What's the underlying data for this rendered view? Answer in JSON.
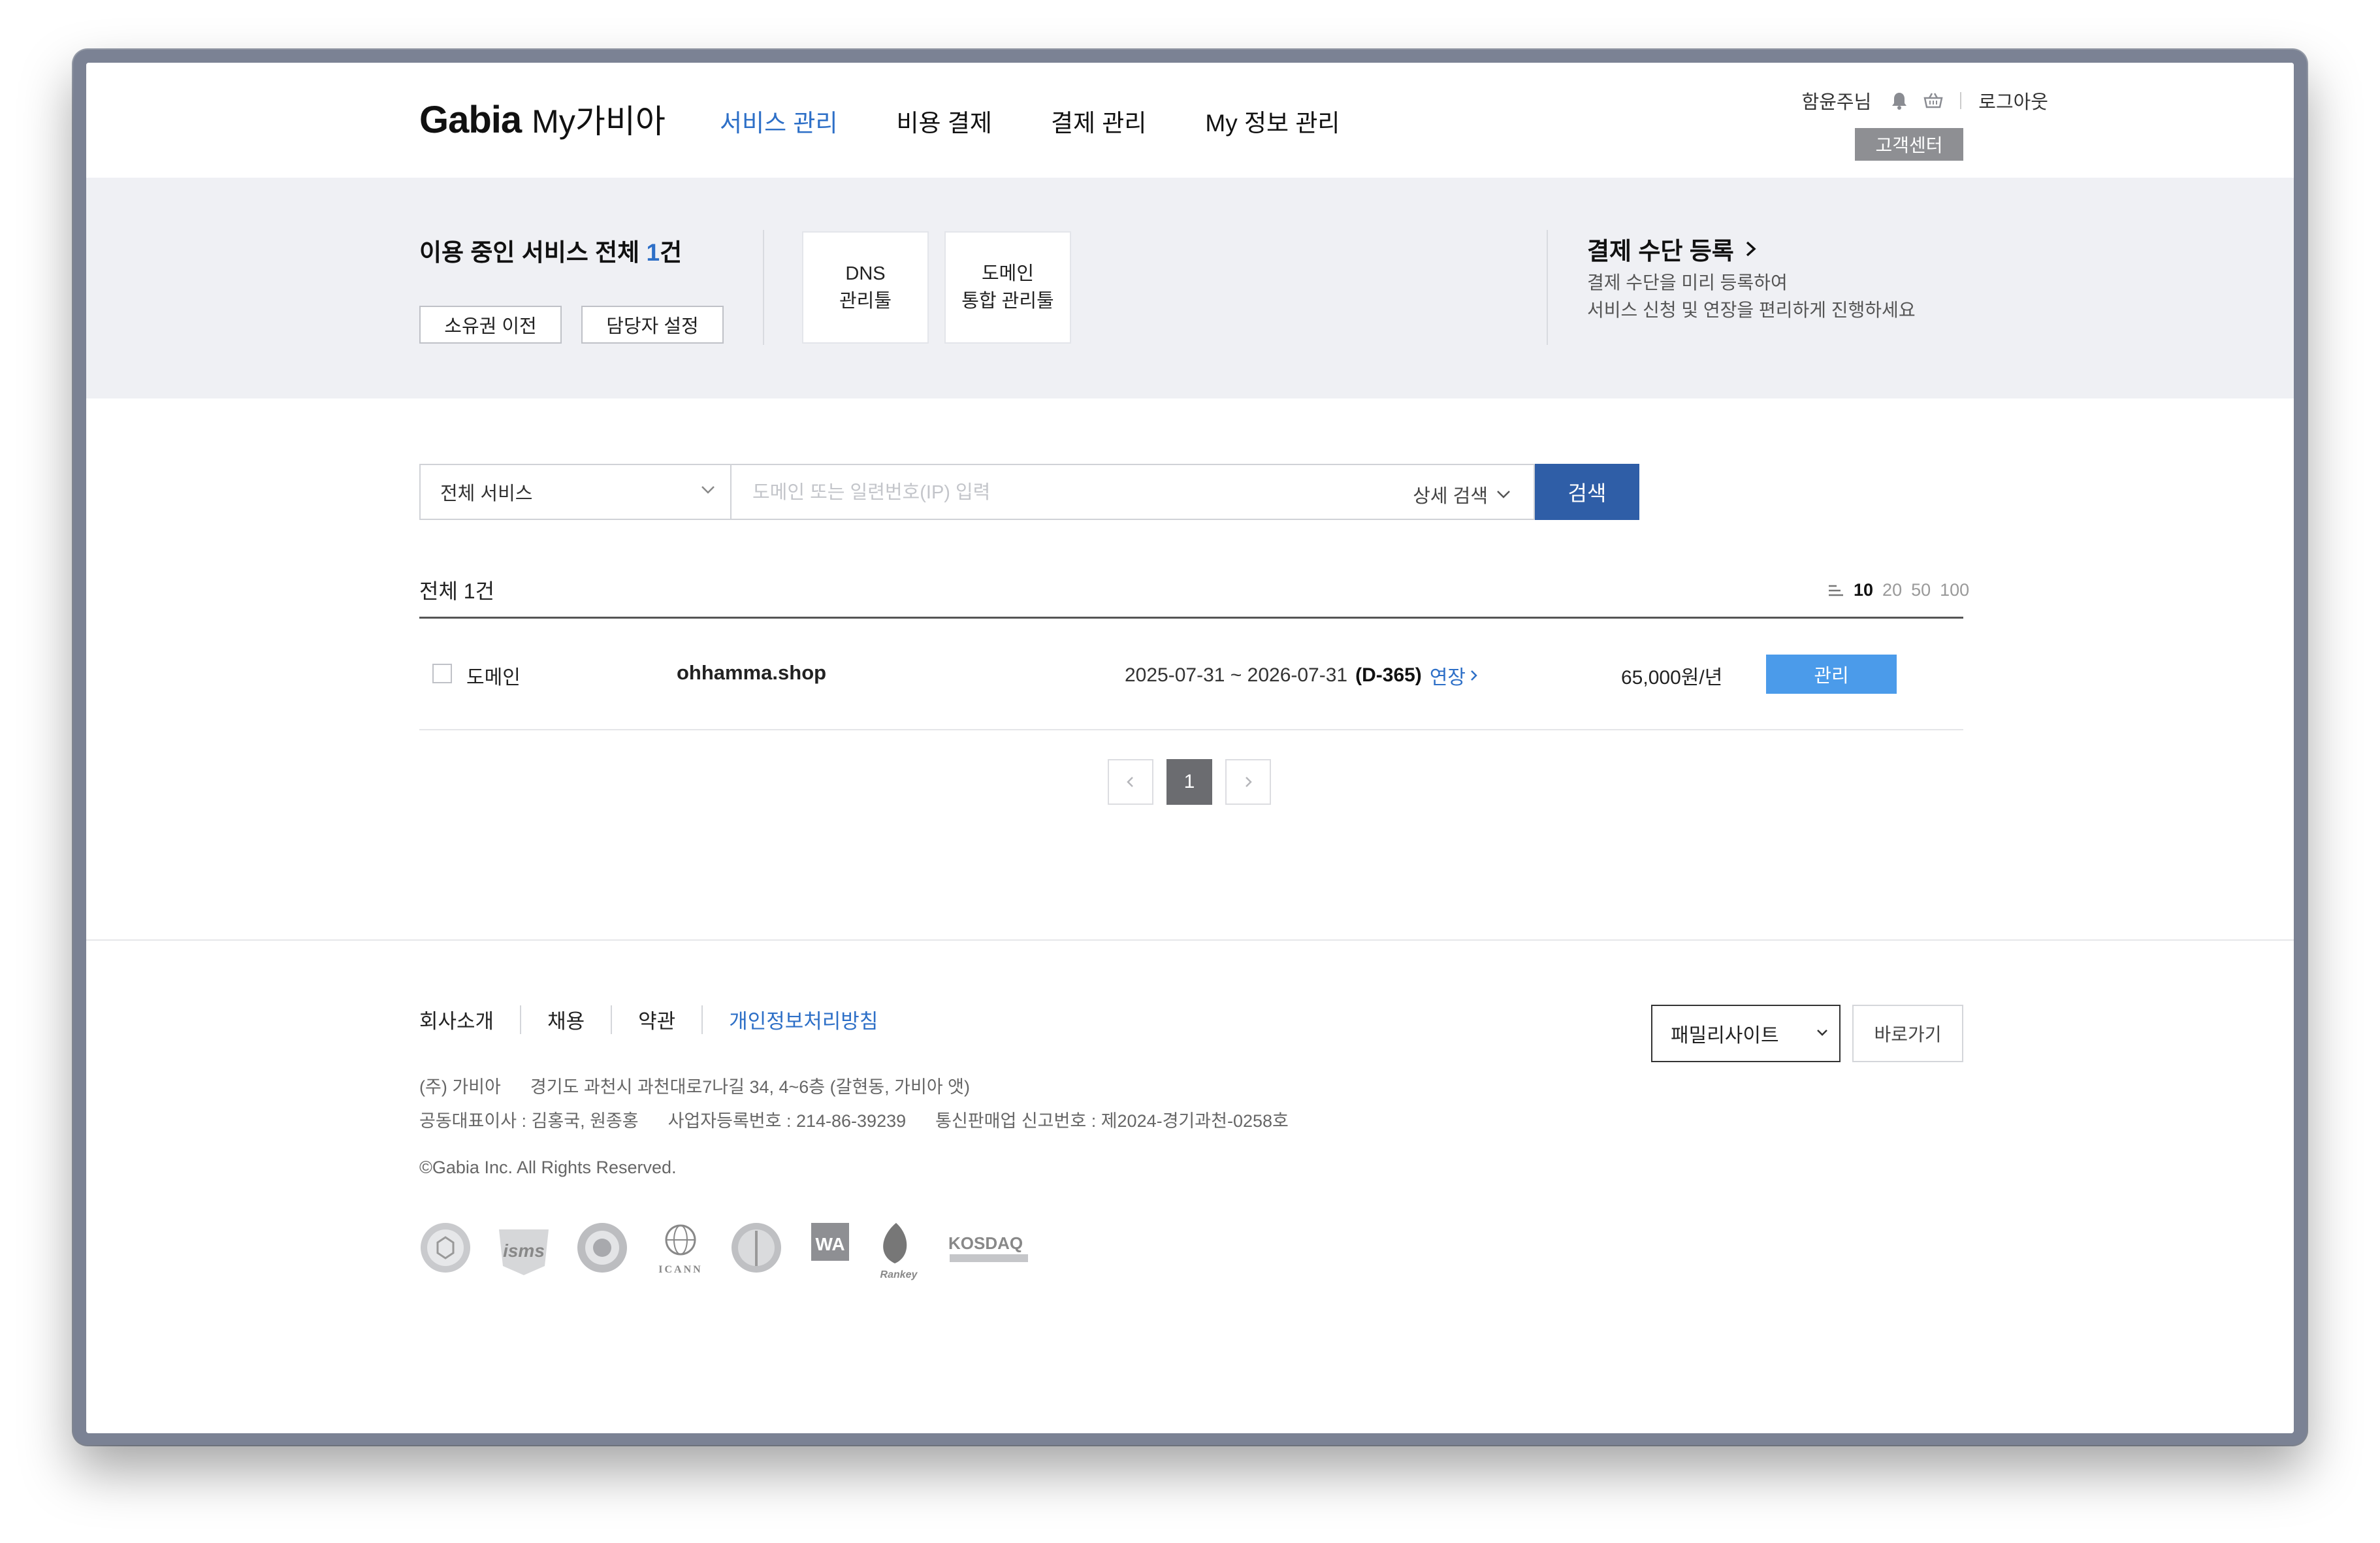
{
  "header": {
    "brand": "Gabia",
    "brand_sub": "My가비아",
    "nav": [
      {
        "label": "서비스 관리",
        "active": true
      },
      {
        "label": "비용 결제",
        "active": false
      },
      {
        "label": "결제 관리",
        "active": false
      },
      {
        "label": "My 정보 관리",
        "active": false
      }
    ],
    "user_name": "함윤주님",
    "logout": "로그아웃",
    "customer_center": "고객센터"
  },
  "summary": {
    "title_prefix": "이용 중인 서비스 전체 ",
    "count": "1",
    "title_suffix": "건",
    "ownership_btn": "소유권 이전",
    "manager_btn": "담당자 설정",
    "tools": [
      {
        "line1": "DNS",
        "line2": "관리툴"
      },
      {
        "line1": "도메인",
        "line2": "통합 관리툴"
      }
    ],
    "payment_title": "결제 수단 등록",
    "payment_desc1": "결제 수단을 미리 등록하여",
    "payment_desc2": "서비스 신청 및 연장을 편리하게 진행하세요"
  },
  "search": {
    "service_select": "전체 서비스",
    "placeholder": "도메인 또는 일련번호(IP) 입력",
    "advanced": "상세 검색",
    "button": "검색"
  },
  "list": {
    "total": "전체 1건",
    "page_sizes": [
      "10",
      "20",
      "50",
      "100"
    ],
    "selected_page_size": "10",
    "rows": [
      {
        "type": "도메인",
        "domain": "ohhamma.shop",
        "period": "2025-07-31 ~ 2026-07-31",
        "dday": "(D-365)",
        "renew": "연장",
        "price": "65,000원/년",
        "manage": "관리"
      }
    ],
    "pagination": {
      "current": "1"
    }
  },
  "footer": {
    "links": [
      {
        "label": "회사소개",
        "highlight": false
      },
      {
        "label": "채용",
        "highlight": false
      },
      {
        "label": "약관",
        "highlight": false
      },
      {
        "label": "개인정보처리방침",
        "highlight": true
      }
    ],
    "address_line": "(주) 가비아      경기도 과천시 과천대로7나길 34, 4~6층 (갈현동, 가비아 앳)",
    "reg_line": "공동대표이사 : 김홍국, 원종홍      사업자등록번호 : 214-86-39239      통신판매업 신고번호 : 제2024-경기과천-0258호",
    "copyright": "©Gabia Inc. All Rights Reserved.",
    "family_site": "패밀리사이트",
    "go_button": "바로가기",
    "cert_logos": [
      "ISMS",
      "ICANN",
      "KOSDAQ",
      "Rankey",
      "WA"
    ]
  },
  "colors": {
    "accent": "#2d6fc7",
    "search_button": "#2f5ea7",
    "manage_button": "#4b9bea",
    "band": "#eff0f4"
  }
}
